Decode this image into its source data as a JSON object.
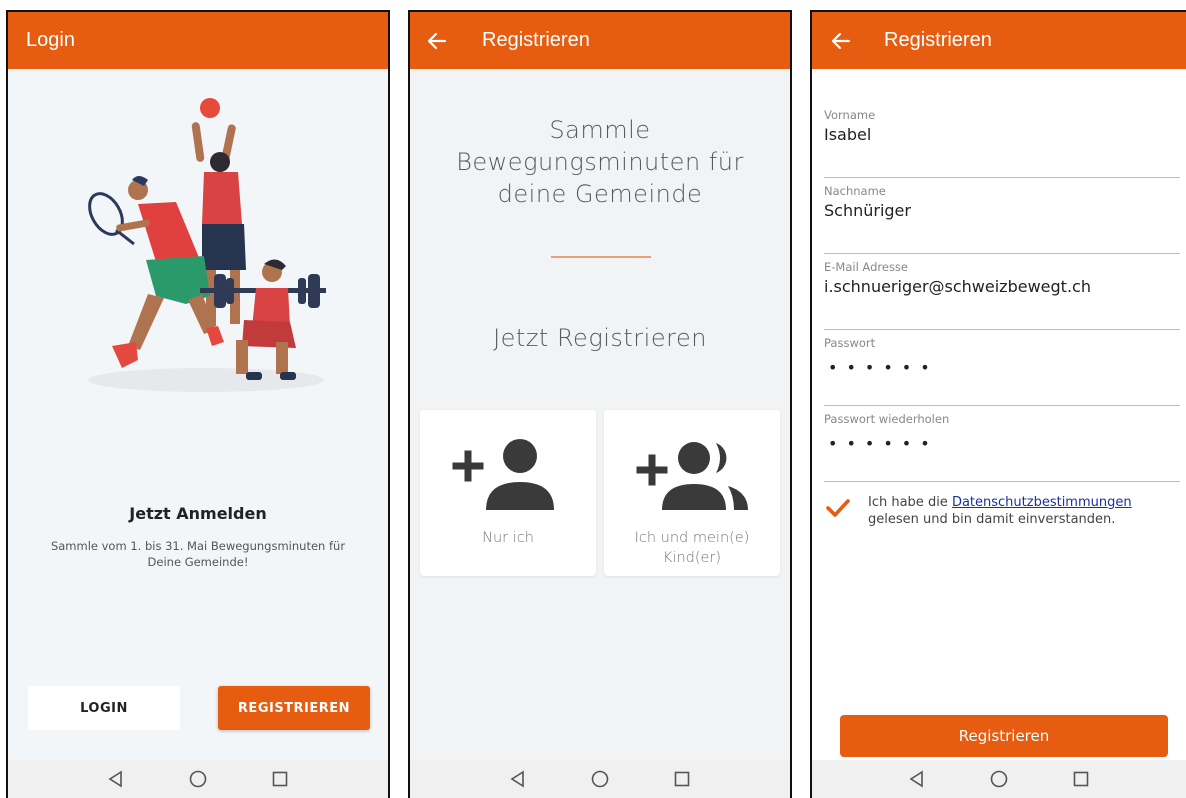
{
  "screens": {
    "login": {
      "title": "Login",
      "heading": "Jetzt Anmelden",
      "subtitle": "Sammle vom 1. bis 31. Mai Bewegungsminuten für Deine Gemeinde!",
      "login_label": "LOGIN",
      "register_label": "REGISTRIEREN"
    },
    "register_choice": {
      "title": "Registrieren",
      "headline": "Sammle Bewegungsminuten für deine Gemeinde",
      "subheadline": "Jetzt Registrieren",
      "options": [
        {
          "label": "Nur ich",
          "icon": "add-person-icon"
        },
        {
          "label": "Ich und mein(e) Kind(er)",
          "icon": "add-group-icon"
        }
      ]
    },
    "register_form": {
      "title": "Registrieren",
      "fields": [
        {
          "label": "Vorname",
          "value": "Isabel"
        },
        {
          "label": "Nachname",
          "value": "Schnüriger"
        },
        {
          "label": "E-Mail Adresse",
          "value": "i.schnueriger@schweizbewegt.ch"
        },
        {
          "label": "Passwort",
          "value": "••••••"
        },
        {
          "label": "Passwort wiederholen",
          "value": "••••••"
        }
      ],
      "consent": {
        "prefix": "Ich habe die ",
        "link": "Datenschutzbestimmungen",
        "suffix": "gelesen und bin damit einverstanden.",
        "checked": true
      },
      "submit_label": "Registrieren"
    }
  },
  "navbar": [
    "back-triangle-icon",
    "home-circle-icon",
    "recents-square-icon"
  ],
  "colors": {
    "accent": "#e65c10",
    "link": "#1a2fa0",
    "background": "#f2f6f9"
  }
}
